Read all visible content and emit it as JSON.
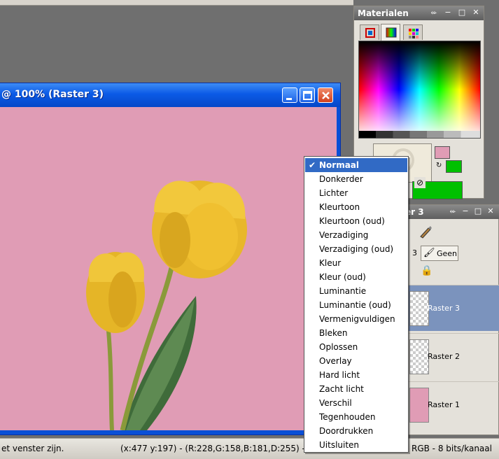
{
  "document": {
    "title": "@ 100% (Raster 3)"
  },
  "status": {
    "hint": "et venster zijn.",
    "info": "(x:477 y:197) - (R:228,G:158,B:181,D:255) --",
    "mode": "RGB - 8 bits/kanaal"
  },
  "materials": {
    "title": "Materialen",
    "controls": [
      "⬰",
      "−",
      "□",
      "✕"
    ]
  },
  "layers": {
    "title": "er 3",
    "number_fragment": "3",
    "mask_label": "Geen",
    "items": [
      {
        "name": "Raster 3",
        "selected": true
      },
      {
        "name": "Raster 2",
        "selected": false
      },
      {
        "name": "Raster 1",
        "selected": false
      }
    ]
  },
  "blend_menu": {
    "selected": "Normaal",
    "items": [
      "Normaal",
      "Donkerder",
      "Lichter",
      "Kleurtoon",
      "Kleurtoon (oud)",
      "Verzadiging",
      "Verzadiging (oud)",
      "Kleur",
      "Kleur (oud)",
      "Luminantie",
      "Luminantie (oud)",
      "Vermenigvuldigen",
      "Bleken",
      "Oplossen",
      "Overlay",
      "Hard licht",
      "Zacht licht",
      "Verschil",
      "Tegenhouden",
      "Doordrukken",
      "Uitsluiten"
    ]
  },
  "colors": {
    "canvas": "#e09cb5",
    "foreground": "#00c000",
    "accent": "#316ac5"
  }
}
